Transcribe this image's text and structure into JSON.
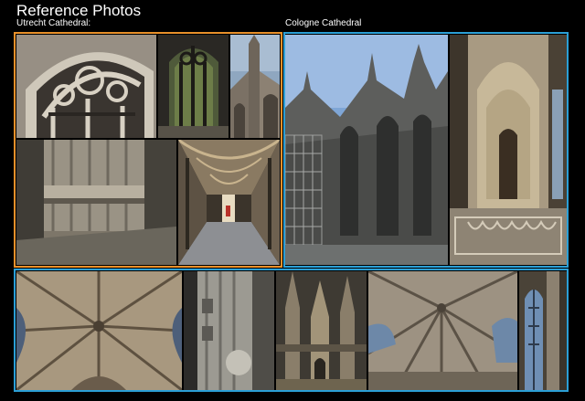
{
  "header": {
    "title": "Reference Photos"
  },
  "groups": {
    "utrecht": {
      "label": "Utrecht Cathedral:",
      "frame_color": "#e8902a"
    },
    "cologne": {
      "label": "Cologne Cathedral",
      "frame_color": "#2b9fd6"
    },
    "bottom": {
      "frame_color": "#2b9fd6"
    }
  }
}
